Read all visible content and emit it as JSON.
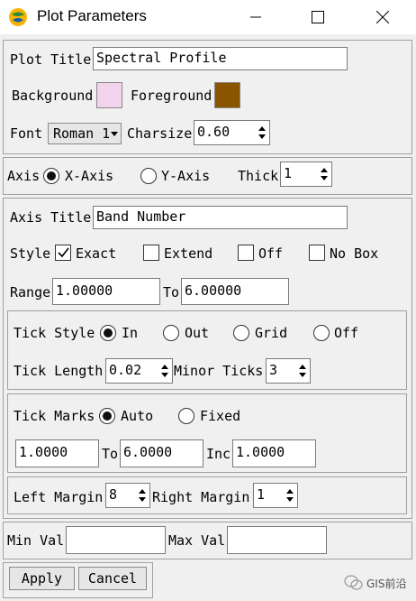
{
  "window": {
    "title": "Plot Parameters"
  },
  "plot": {
    "title_label": "Plot Title",
    "title_value": "Spectral Profile",
    "background_label": "Background",
    "background_color": "#f2d4ec",
    "foreground_label": "Foreground",
    "foreground_color": "#8b5500",
    "font_label": "Font",
    "font_value": "Roman 1",
    "charsize_label": "Charsize",
    "charsize_value": "0.60"
  },
  "axis": {
    "label": "Axis",
    "x_label": "X-Axis",
    "y_label": "Y-Axis",
    "selected": "X-Axis",
    "thick_label": "Thick",
    "thick_value": "1"
  },
  "axis_settings": {
    "title_label": "Axis Title",
    "title_value": "Band Number",
    "style_label": "Style",
    "style_options": [
      {
        "label": "Exact",
        "checked": true
      },
      {
        "label": "Extend",
        "checked": false
      },
      {
        "label": "Off",
        "checked": false
      },
      {
        "label": "No Box",
        "checked": false
      }
    ],
    "range_label": "Range",
    "range_from": "1.00000",
    "to_label": "To",
    "range_to": "6.00000"
  },
  "tick": {
    "style_label": "Tick Style",
    "style_options": [
      "In",
      "Out",
      "Grid",
      "Off"
    ],
    "style_selected": "In",
    "length_label": "Tick Length",
    "length_value": "0.02",
    "minor_label": "Minor Ticks",
    "minor_value": "3"
  },
  "tick_marks": {
    "label": "Tick Marks",
    "auto_label": "Auto",
    "fixed_label": "Fixed",
    "selected": "Auto",
    "from_value": "1.0000",
    "to_label": "To",
    "to_value": "6.0000",
    "inc_label": "Inc",
    "inc_value": "1.0000"
  },
  "margins": {
    "left_label": "Left Margin",
    "left_value": "8",
    "right_label": "Right Margin",
    "right_value": "1"
  },
  "values": {
    "min_label": "Min Val",
    "min_value": "",
    "max_label": "Max Val",
    "max_value": ""
  },
  "buttons": {
    "apply": "Apply",
    "cancel": "Cancel"
  },
  "watermark": {
    "text": "GIS前沿",
    "icon": "wechat-icon"
  }
}
